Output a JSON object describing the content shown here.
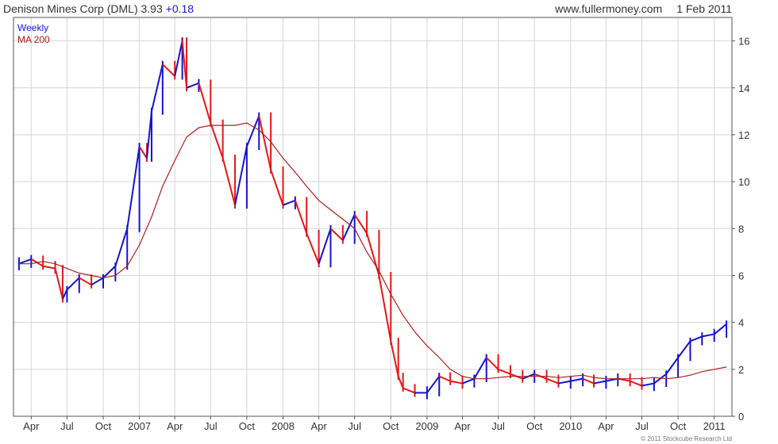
{
  "header": {
    "title": "Denison Mines Corp (DML) 3.93",
    "change": "+0.18",
    "website": "www.fullermoney.com",
    "date": "1 Feb 2011"
  },
  "legend": {
    "weekly": "Weekly",
    "ma": "MA 200"
  },
  "copyright": "© 2011 Stockcube Research Ltd",
  "colors": {
    "up": "#1414cc",
    "down": "#e01818",
    "ma": "#a82020",
    "grid": "#d6d6d6",
    "frame": "#555555"
  },
  "chart_data": {
    "type": "line",
    "series": [
      {
        "name": "Weekly",
        "x": [
          "2006-03-01",
          "2006-04-01",
          "2006-05-01",
          "2006-06-01",
          "2006-06-20",
          "2006-07-01",
          "2006-08-01",
          "2006-09-01",
          "2006-10-01",
          "2006-11-01",
          "2006-12-01",
          "2007-01-01",
          "2007-01-20",
          "2007-02-01",
          "2007-03-01",
          "2007-04-01",
          "2007-04-20",
          "2007-05-01",
          "2007-06-01",
          "2007-07-01",
          "2007-08-01",
          "2007-09-01",
          "2007-10-01",
          "2007-11-01",
          "2007-12-01",
          "2008-01-01",
          "2008-02-01",
          "2008-03-01",
          "2008-04-01",
          "2008-05-01",
          "2008-06-01",
          "2008-07-01",
          "2008-08-01",
          "2008-09-01",
          "2008-10-01",
          "2008-10-20",
          "2008-11-01",
          "2008-12-01",
          "2009-01-01",
          "2009-02-01",
          "2009-03-01",
          "2009-04-01",
          "2009-05-01",
          "2009-06-01",
          "2009-07-01",
          "2009-08-01",
          "2009-09-01",
          "2009-10-01",
          "2009-11-01",
          "2009-12-01",
          "2010-01-01",
          "2010-02-01",
          "2010-03-01",
          "2010-04-01",
          "2010-05-01",
          "2010-06-01",
          "2010-07-01",
          "2010-08-01",
          "2010-09-01",
          "2010-10-01",
          "2010-11-01",
          "2010-12-01",
          "2011-01-01",
          "2011-02-01"
        ],
        "y": [
          6.5,
          6.7,
          6.4,
          6.3,
          5.0,
          5.4,
          5.9,
          5.6,
          5.9,
          6.4,
          8.0,
          11.5,
          11.0,
          13.0,
          15.0,
          14.5,
          16.0,
          14.0,
          14.2,
          12.5,
          11.0,
          9.0,
          11.5,
          12.8,
          10.5,
          9.0,
          9.2,
          7.8,
          6.5,
          8.0,
          7.5,
          8.6,
          7.8,
          6.0,
          3.2,
          1.7,
          1.2,
          1.0,
          1.0,
          1.7,
          1.5,
          1.4,
          1.6,
          2.5,
          2.0,
          1.8,
          1.6,
          1.8,
          1.6,
          1.4,
          1.5,
          1.6,
          1.4,
          1.5,
          1.6,
          1.5,
          1.3,
          1.4,
          1.8,
          2.5,
          3.2,
          3.4,
          3.5,
          3.93
        ]
      },
      {
        "name": "MA 200",
        "x": [
          "2006-03-01",
          "2006-04-01",
          "2006-05-01",
          "2006-06-01",
          "2006-07-01",
          "2006-08-01",
          "2006-09-01",
          "2006-10-01",
          "2006-11-01",
          "2006-12-01",
          "2007-01-01",
          "2007-02-01",
          "2007-03-01",
          "2007-04-01",
          "2007-05-01",
          "2007-06-01",
          "2007-07-01",
          "2007-08-01",
          "2007-09-01",
          "2007-10-01",
          "2007-11-01",
          "2007-12-01",
          "2008-01-01",
          "2008-02-01",
          "2008-03-01",
          "2008-04-01",
          "2008-05-01",
          "2008-06-01",
          "2008-07-01",
          "2008-08-01",
          "2008-09-01",
          "2008-10-01",
          "2008-11-01",
          "2008-12-01",
          "2009-01-01",
          "2009-02-01",
          "2009-03-01",
          "2009-04-01",
          "2009-05-01",
          "2009-06-01",
          "2009-07-01",
          "2009-08-01",
          "2009-09-01",
          "2009-10-01",
          "2009-11-01",
          "2009-12-01",
          "2010-01-01",
          "2010-02-01",
          "2010-03-01",
          "2010-04-01",
          "2010-05-01",
          "2010-06-01",
          "2010-07-01",
          "2010-08-01",
          "2010-09-01",
          "2010-10-01",
          "2010-11-01",
          "2010-12-01",
          "2011-01-01",
          "2011-02-01"
        ],
        "y": [
          6.5,
          6.5,
          6.6,
          6.5,
          6.3,
          6.1,
          6.0,
          5.9,
          6.0,
          6.4,
          7.3,
          8.5,
          9.8,
          10.9,
          11.9,
          12.3,
          12.4,
          12.4,
          12.4,
          12.5,
          12.2,
          11.7,
          11.0,
          10.4,
          9.8,
          9.2,
          8.8,
          8.4,
          8.0,
          7.0,
          6.2,
          5.2,
          4.3,
          3.6,
          3.0,
          2.5,
          2.0,
          1.7,
          1.6,
          1.6,
          1.65,
          1.7,
          1.7,
          1.7,
          1.7,
          1.65,
          1.7,
          1.75,
          1.65,
          1.6,
          1.6,
          1.6,
          1.6,
          1.65,
          1.6,
          1.65,
          1.75,
          1.9,
          2.0,
          2.1
        ]
      }
    ],
    "x_ticks": [
      "Apr",
      "Jul",
      "Oct",
      "2007",
      "Apr",
      "Jul",
      "Oct",
      "2008",
      "Apr",
      "Jul",
      "Oct",
      "2009",
      "Apr",
      "Jul",
      "Oct",
      "2010",
      "Apr",
      "Jul",
      "Oct",
      "2011"
    ],
    "y_ticks": [
      "0",
      "2",
      "4",
      "6",
      "8",
      "10",
      "12",
      "14",
      "16"
    ],
    "xlim": [
      "2006-02-15",
      "2011-02-15"
    ],
    "ylim": [
      0,
      17
    ],
    "grid": true,
    "legend_position": "top-left",
    "y_axis_side": "right"
  }
}
